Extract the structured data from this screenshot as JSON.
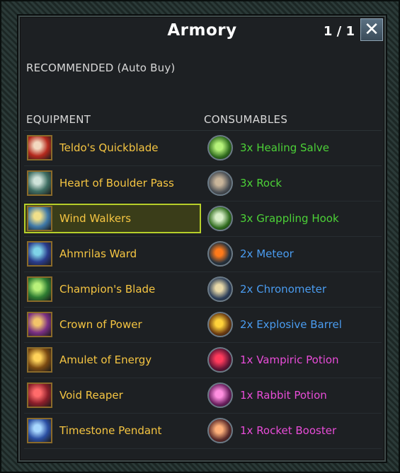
{
  "window": {
    "title": "Armory",
    "page_counter": "1 / 1",
    "close_glyph": "✕"
  },
  "recommended_label": "RECOMMENDED (Auto Buy)",
  "headers": {
    "equipment": "EQUIPMENT",
    "consumables": "CONSUMABLES"
  },
  "equipment": [
    {
      "name": "Teldo's Quickblade",
      "icon": "dagger-icon",
      "bg": "#b52a1e",
      "fg": "#f3d9c0",
      "selected": false
    },
    {
      "name": "Heart of Boulder Pass",
      "icon": "armor-chest-icon",
      "bg": "#3f6e63",
      "fg": "#cfe3da",
      "selected": false
    },
    {
      "name": "Wind Walkers",
      "icon": "winged-boots-icon",
      "bg": "#3f79a8",
      "fg": "#f0e08a",
      "selected": true
    },
    {
      "name": "Ahmrilas Ward",
      "icon": "leaf-ward-icon",
      "bg": "#2a3c8c",
      "fg": "#7fd3e8",
      "selected": false
    },
    {
      "name": "Champion's Blade",
      "icon": "green-sword-icon",
      "bg": "#2e7d32",
      "fg": "#b9f27a",
      "selected": false
    },
    {
      "name": "Crown of Power",
      "icon": "crown-icon",
      "bg": "#7a2f84",
      "fg": "#f2c46a",
      "selected": false
    },
    {
      "name": "Amulet of Energy",
      "icon": "amulet-icon",
      "bg": "#7a4a12",
      "fg": "#ffd35a",
      "selected": false
    },
    {
      "name": "Void Reaper",
      "icon": "axe-icon",
      "bg": "#8c1f2a",
      "fg": "#ff6b6b",
      "selected": false
    },
    {
      "name": "Timestone Pendant",
      "icon": "pendant-icon",
      "bg": "#2b4fa3",
      "fg": "#a8d8ff",
      "selected": false
    }
  ],
  "consumables": [
    {
      "name": "3x Healing Salve",
      "icon": "healing-flask-icon",
      "color": "#4cd137",
      "bg": "#2f6b1e",
      "fg": "#b6f27a"
    },
    {
      "name": "3x Rock",
      "icon": "rock-icon",
      "color": "#4cd137",
      "bg": "#4a4f55",
      "fg": "#c9b59a"
    },
    {
      "name": "3x Grappling Hook",
      "icon": "grappling-hook-icon",
      "color": "#4cd137",
      "bg": "#2f6b1e",
      "fg": "#d9f0c9"
    },
    {
      "name": "2x Meteor",
      "icon": "meteor-icon",
      "color": "#4a9cf0",
      "bg": "#26323e",
      "fg": "#ff7a1a"
    },
    {
      "name": "2x Chronometer",
      "icon": "hourglass-icon",
      "color": "#4a9cf0",
      "bg": "#2d3f5a",
      "fg": "#e9d9a8"
    },
    {
      "name": "2x Explosive Barrel",
      "icon": "explosion-icon",
      "color": "#4a9cf0",
      "bg": "#6b3b12",
      "fg": "#ffd23a"
    },
    {
      "name": "1x Vampiric Potion",
      "icon": "vampiric-potion-icon",
      "color": "#e84cd8",
      "bg": "#5c1434",
      "fg": "#ff3b5c"
    },
    {
      "name": "1x Rabbit Potion",
      "icon": "rabbit-potion-icon",
      "color": "#e84cd8",
      "bg": "#6a1f5e",
      "fg": "#ff8fe0"
    },
    {
      "name": "1x Rocket Booster",
      "icon": "rocket-booster-icon",
      "color": "#e84cd8",
      "bg": "#5a2a2a",
      "fg": "#ffb07a"
    }
  ]
}
